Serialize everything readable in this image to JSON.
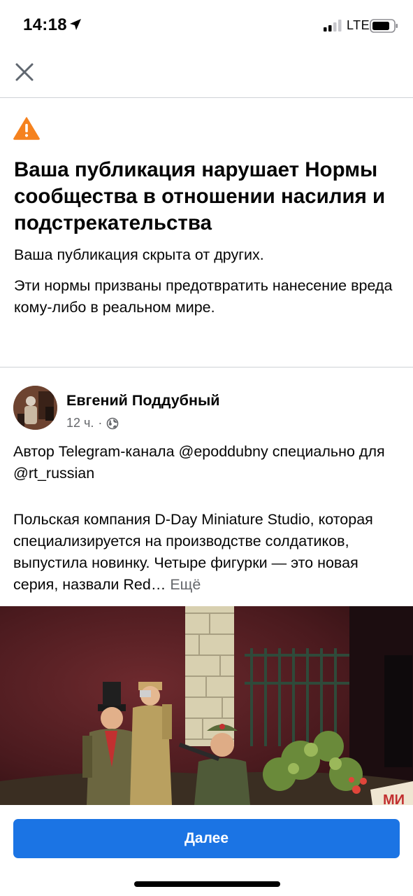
{
  "status_bar": {
    "time": "14:18",
    "network": "LTE",
    "icons": [
      "location-arrow-icon",
      "signal-icon",
      "battery-icon"
    ]
  },
  "top_bar": {
    "close_icon": "close-icon"
  },
  "warning": {
    "icon": "warning-triangle-icon",
    "icon_color": "#f5821f",
    "title": "Ваша публикация нарушает Нормы сообщества в отношении насилия и подстрекательства",
    "line1": "Ваша публикация скрыта от других.",
    "line2": "Эти нормы призваны предотвратить нанесение вреда кому-либо в реальном мире."
  },
  "post": {
    "author": "Евгений Поддубный",
    "time": "12 ч.",
    "separator": "·",
    "audience_icon": "globe-icon",
    "paragraph1": "Автор Telegram-канала @epoddubny специально для @rt_russian",
    "paragraph2": "Польская компания D-Day Miniature Studio, которая специализируется на производстве солдатиков, выпустила новинку. Четыре фигурки — это новая серия, назвали Red…",
    "more_label": "Ещё",
    "image_sign_text": "МИ"
  },
  "bottom": {
    "next_label": "Далее",
    "button_color": "#1b74e4"
  }
}
